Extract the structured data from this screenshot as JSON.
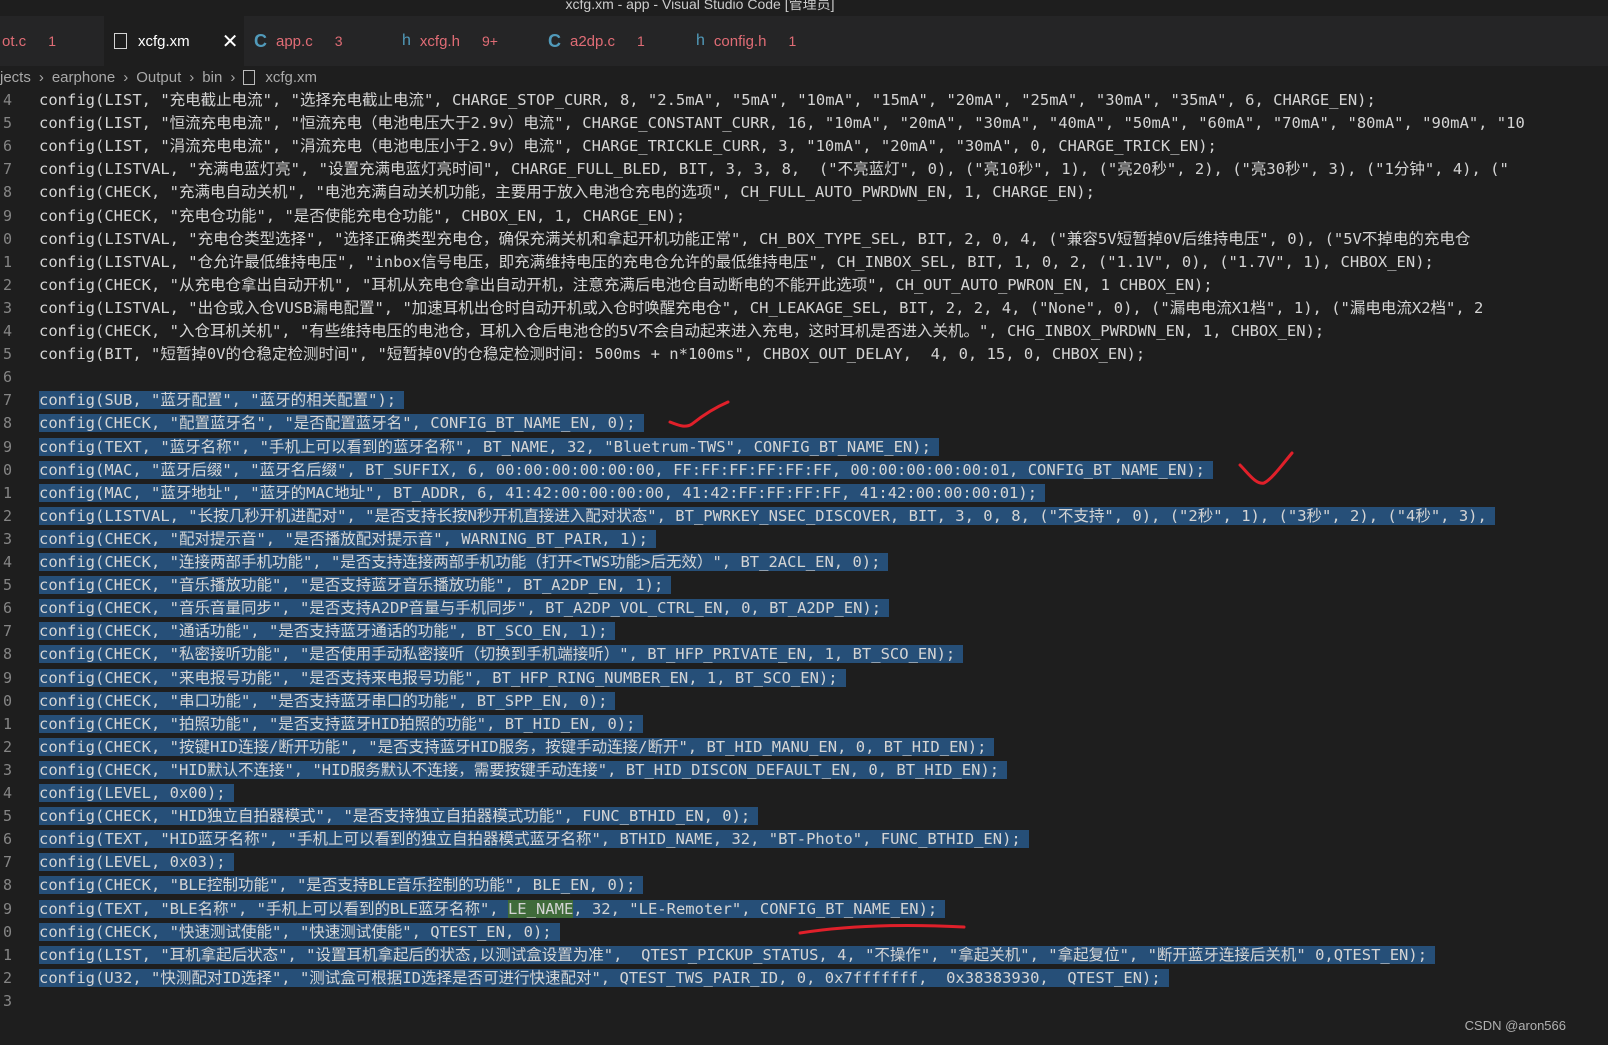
{
  "window": {
    "title": "xcfg.xm - app - Visual Studio Code [管理员]"
  },
  "tabs": [
    {
      "icon": "",
      "name": "ot.c",
      "count": "1"
    },
    {
      "icon": "file",
      "name": "xcfg.xm",
      "count": "",
      "close": "✕"
    },
    {
      "icon": "C",
      "name": "app.c",
      "count": "3"
    },
    {
      "icon": "h",
      "name": "xcfg.h",
      "count": "9+"
    },
    {
      "icon": "C",
      "name": "a2dp.c",
      "count": "1"
    },
    {
      "icon": "h",
      "name": "config.h",
      "count": "1"
    }
  ],
  "breadcrumb": {
    "items": [
      "jects",
      "earphone",
      "Output",
      "bin",
      "xcfg.xm"
    ]
  },
  "editor": {
    "lines": [
      {
        "ln": "4",
        "text": "config(LIST, \"充电截止电流\", \"选择充电截止电流\", CHARGE_STOP_CURR, 8, \"2.5mA\", \"5mA\", \"10mA\", \"15mA\", \"20mA\", \"25mA\", \"30mA\", \"35mA\", 6, CHARGE_EN);",
        "sel": false
      },
      {
        "ln": "5",
        "text": "config(LIST, \"恒流充电电流\", \"恒流充电（电池电压大于2.9v）电流\", CHARGE_CONSTANT_CURR, 16, \"10mA\", \"20mA\", \"30mA\", \"40mA\", \"50mA\", \"60mA\", \"70mA\", \"80mA\", \"90mA\", \"10",
        "sel": false
      },
      {
        "ln": "6",
        "text": "config(LIST, \"涓流充电电流\", \"涓流充电（电池电压小于2.9v）电流\", CHARGE_TRICKLE_CURR, 3, \"10mA\", \"20mA\", \"30mA\", 0, CHARGE_TRICK_EN);",
        "sel": false
      },
      {
        "ln": "7",
        "text": "config(LISTVAL, \"充满电蓝灯亮\", \"设置充满电蓝灯亮时间\", CHARGE_FULL_BLED, BIT, 3, 3, 8,  (\"不亮蓝灯\", 0), (\"亮10秒\", 1), (\"亮20秒\", 2), (\"亮30秒\", 3), (\"1分钟\", 4), (\"",
        "sel": false
      },
      {
        "ln": "8",
        "text": "config(CHECK, \"充满电自动关机\", \"电池充满自动关机功能，主要用于放入电池仓充电的选项\", CH_FULL_AUTO_PWRDWN_EN, 1, CHARGE_EN);",
        "sel": false
      },
      {
        "ln": "9",
        "text": "config(CHECK, \"充电仓功能\", \"是否使能充电仓功能\", CHBOX_EN, 1, CHARGE_EN);",
        "sel": false
      },
      {
        "ln": "0",
        "text": "config(LISTVAL, \"充电仓类型选择\", \"选择正确类型充电仓，确保充满关机和拿起开机功能正常\", CH_BOX_TYPE_SEL, BIT, 2, 0, 4, (\"兼容5V短暂掉0V后维持电压\", 0), (\"5V不掉电的充电仓",
        "sel": false
      },
      {
        "ln": "1",
        "text": "config(LISTVAL, \"仓允许最低维持电压\", \"inbox信号电压，即充满维持电压的充电仓允许的最低维持电压\", CH_INBOX_SEL, BIT, 1, 0, 2, (\"1.1V\", 0), (\"1.7V\", 1), CHBOX_EN);",
        "sel": false
      },
      {
        "ln": "2",
        "text": "config(CHECK, \"从充电仓拿出自动开机\", \"耳机从充电仓拿出自动开机，注意充满后电池仓自动断电的不能开此选项\", CH_OUT_AUTO_PWRON_EN, 1 CHBOX_EN);",
        "sel": false
      },
      {
        "ln": "3",
        "text": "config(LISTVAL, \"出仓或入仓VUSB漏电配置\", \"加速耳机出仓时自动开机或入仓时唤醒充电仓\", CH_LEAKAGE_SEL, BIT, 2, 2, 4, (\"None\", 0), (\"漏电电流X1档\", 1), (\"漏电电流X2档\", 2",
        "sel": false
      },
      {
        "ln": "4",
        "text": "config(CHECK, \"入仓耳机关机\", \"有些维持电压的电池仓，耳机入仓后电池仓的5V不会自动起来进入充电，这时耳机是否进入关机。\", CHG_INBOX_PWRDWN_EN, 1, CHBOX_EN);",
        "sel": false
      },
      {
        "ln": "5",
        "text": "config(BIT, \"短暂掉0V的仓稳定检测时间\", \"短暂掉0V的仓稳定检测时间: 500ms + n*100ms\", CHBOX_OUT_DELAY,  4, 0, 15, 0, CHBOX_EN);",
        "sel": false
      },
      {
        "ln": "6",
        "text": "",
        "sel": false
      },
      {
        "ln": "7",
        "text": "config(SUB, \"蓝牙配置\", \"蓝牙的相关配置\");",
        "sel": true
      },
      {
        "ln": "8",
        "text": "config(CHECK, \"配置蓝牙名\", \"是否配置蓝牙名\", CONFIG_BT_NAME_EN, 0);",
        "sel": true
      },
      {
        "ln": "9",
        "text": "config(TEXT, \"蓝牙名称\", \"手机上可以看到的蓝牙名称\", BT_NAME, 32, \"Bluetrum-TWS\", CONFIG_BT_NAME_EN);",
        "sel": true
      },
      {
        "ln": "0",
        "text": "config(MAC, \"蓝牙后缀\", \"蓝牙名后缀\", BT_SUFFIX, 6, 00:00:00:00:00:00, FF:FF:FF:FF:FF:FF, 00:00:00:00:00:01, CONFIG_BT_NAME_EN);",
        "sel": true
      },
      {
        "ln": "1",
        "text": "config(MAC, \"蓝牙地址\", \"蓝牙的MAC地址\", BT_ADDR, 6, 41:42:00:00:00:00, 41:42:FF:FF:FF:FF, 41:42:00:00:00:01);",
        "sel": true
      },
      {
        "ln": "2",
        "text": "config(LISTVAL, \"长按几秒开机进配对\", \"是否支持长按N秒开机直接进入配对状态\", BT_PWRKEY_NSEC_DISCOVER, BIT, 3, 0, 8, (\"不支持\", 0), (\"2秒\", 1), (\"3秒\", 2), (\"4秒\", 3),",
        "sel": true
      },
      {
        "ln": "3",
        "text": "config(CHECK, \"配对提示音\", \"是否播放配对提示音\", WARNING_BT_PAIR, 1);",
        "sel": true
      },
      {
        "ln": "4",
        "text": "config(CHECK, \"连接两部手机功能\", \"是否支持连接两部手机功能（打开<TWS功能>后无效）\", BT_2ACL_EN, 0);",
        "sel": true
      },
      {
        "ln": "5",
        "text": "config(CHECK, \"音乐播放功能\", \"是否支持蓝牙音乐播放功能\", BT_A2DP_EN, 1);",
        "sel": true
      },
      {
        "ln": "6",
        "text": "config(CHECK, \"音乐音量同步\", \"是否支持A2DP音量与手机同步\", BT_A2DP_VOL_CTRL_EN, 0, BT_A2DP_EN);",
        "sel": true
      },
      {
        "ln": "7",
        "text": "config(CHECK, \"通话功能\", \"是否支持蓝牙通话的功能\", BT_SCO_EN, 1);",
        "sel": true
      },
      {
        "ln": "8",
        "text": "config(CHECK, \"私密接听功能\", \"是否使用手动私密接听（切换到手机端接听）\", BT_HFP_PRIVATE_EN, 1, BT_SCO_EN);",
        "sel": true
      },
      {
        "ln": "9",
        "text": "config(CHECK, \"来电报号功能\", \"是否支持来电报号功能\", BT_HFP_RING_NUMBER_EN, 1, BT_SCO_EN);",
        "sel": true
      },
      {
        "ln": "0",
        "text": "config(CHECK, \"串口功能\", \"是否支持蓝牙串口的功能\", BT_SPP_EN, 0);",
        "sel": true
      },
      {
        "ln": "1",
        "text": "config(CHECK, \"拍照功能\", \"是否支持蓝牙HID拍照的功能\", BT_HID_EN, 0);",
        "sel": true
      },
      {
        "ln": "2",
        "text": "config(CHECK, \"按键HID连接/断开功能\", \"是否支持蓝牙HID服务，按键手动连接/断开\", BT_HID_MANU_EN, 0, BT_HID_EN);",
        "sel": true
      },
      {
        "ln": "3",
        "text": "config(CHECK, \"HID默认不连接\", \"HID服务默认不连接，需要按键手动连接\", BT_HID_DISCON_DEFAULT_EN, 0, BT_HID_EN);",
        "sel": true
      },
      {
        "ln": "4",
        "text": "config(LEVEL, 0x00);",
        "sel": true
      },
      {
        "ln": "5",
        "text": "config(CHECK, \"HID独立自拍器模式\", \"是否支持独立自拍器模式功能\", FUNC_BTHID_EN, 0);",
        "sel": true
      },
      {
        "ln": "6",
        "text": "config(TEXT, \"HID蓝牙名称\", \"手机上可以看到的独立自拍器模式蓝牙名称\", BTHID_NAME, 32, \"BT-Photo\", FUNC_BTHID_EN);",
        "sel": true
      },
      {
        "ln": "7",
        "text": "config(LEVEL, 0x03);",
        "sel": true
      },
      {
        "ln": "8",
        "text": "config(CHECK, \"BLE控制功能\", \"是否支持BLE音乐控制的功能\", BLE_EN, 0);",
        "sel": true
      },
      {
        "ln": "9",
        "pre": "config(TEXT, \"BLE名称\", \"手机上可以看到的BLE蓝牙名称\", ",
        "hl": "LE_NAME",
        "post": ", 32, \"LE-Remoter\", CONFIG_BT_NAME_EN);",
        "sel": true
      },
      {
        "ln": "0",
        "text": "config(CHECK, \"快速测试使能\", \"快速测试使能\", QTEST_EN, 0);",
        "sel": true
      },
      {
        "ln": "1",
        "text": "config(LIST, \"耳机拿起后状态\", \"设置耳机拿起后的状态,以测试盒设置为准\",  QTEST_PICKUP_STATUS, 4, \"不操作\", \"拿起关机\", \"拿起复位\", \"断开蓝牙连接后关机\" 0,QTEST_EN);",
        "sel": true
      },
      {
        "ln": "2",
        "text": "config(U32, \"快测配对ID选择\", \"测试盒可根据ID选择是否可进行快速配对\", QTEST_TWS_PAIR_ID, 0, 0x7fffffff,  0x38383930,  QTEST_EN);",
        "sel": true
      },
      {
        "ln": "3",
        "text": "",
        "sel": false
      }
    ]
  },
  "annotations": {
    "color": "#e0202a"
  },
  "watermark": "CSDN @aron566",
  "colors": {
    "background": "#1e1e1e",
    "selection": "#264f78",
    "highlight": "#3f6b3a",
    "tab_error": "#e06c75"
  }
}
